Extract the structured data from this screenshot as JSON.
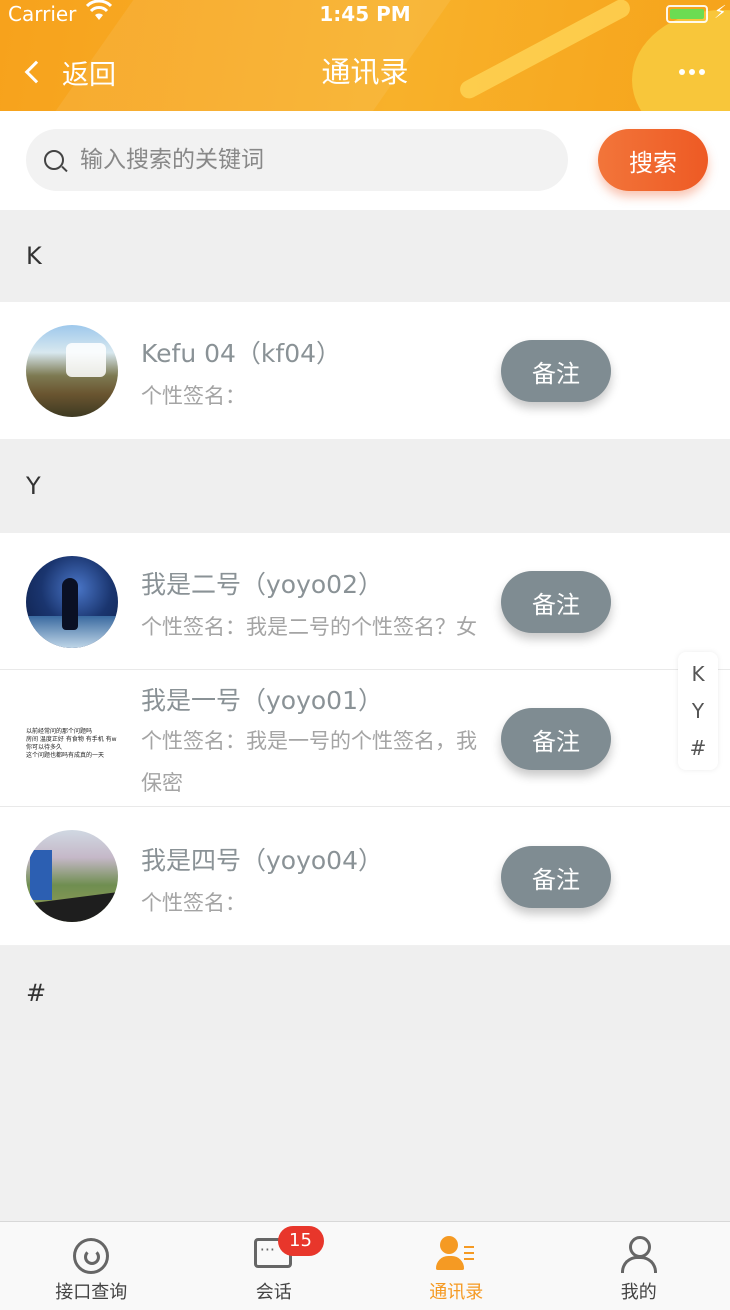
{
  "status_bar": {
    "carrier": "Carrier",
    "time": "1:45 PM"
  },
  "nav": {
    "back_label": "返回",
    "title": "通讯录"
  },
  "search": {
    "placeholder": "输入搜索的关键词",
    "button_label": "搜索"
  },
  "sections": [
    {
      "letter": "K"
    },
    {
      "letter": "Y"
    },
    {
      "letter": "#"
    }
  ],
  "contacts": [
    {
      "name": "Kefu 04（kf04）",
      "signature": "个性签名：",
      "note_label": "备注"
    },
    {
      "name": "我是二号（yoyo02）",
      "signature": "个性签名：我是二号的个性签名？女 ",
      "note_label": "备注"
    },
    {
      "name": "我是一号（yoyo01）",
      "signature": "个性签名：我是一号的个性签名，我",
      "signature_line2": "保密",
      "note_label": "备注"
    },
    {
      "name": "我是四号（yoyo04）",
      "signature": "个性签名：",
      "note_label": "备注"
    }
  ],
  "avatar3_text": [
    "以前经常问的那个问题吗",
    "房间 温度正好 有食物 有手机 有w",
    "你可以待多久",
    "这个问题也都吗有成真的一天"
  ],
  "index_letters": [
    "K",
    "Y",
    "#"
  ],
  "tabs": [
    {
      "label": "接口查询",
      "icon": "query-icon"
    },
    {
      "label": "会话",
      "icon": "chat-icon",
      "badge": "15"
    },
    {
      "label": "通讯录",
      "icon": "contacts-icon",
      "active": true
    },
    {
      "label": "我的",
      "icon": "profile-icon"
    }
  ],
  "colors": {
    "accent": "#f59a23",
    "search_button": "#ee5a24",
    "note_button": "#7f8c92",
    "badge": "#e8362b"
  }
}
